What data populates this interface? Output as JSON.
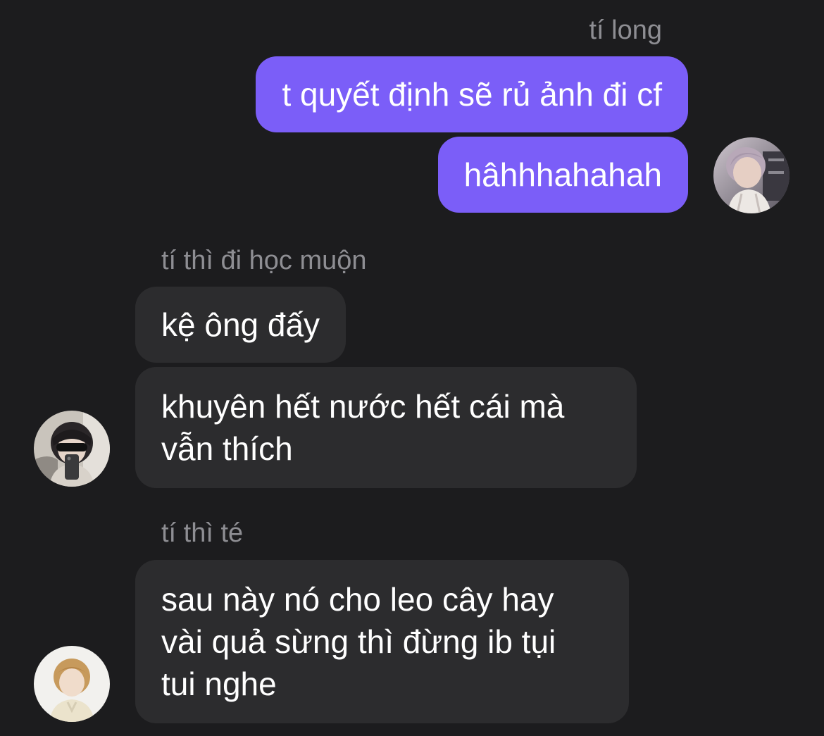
{
  "groups": [
    {
      "sender": "tí long",
      "direction": "outgoing",
      "avatar_icon": "user-avatar-icon",
      "messages": [
        {
          "lines": [
            "t quyết định sẽ rủ ảnh đi cf"
          ]
        },
        {
          "lines": [
            "hâhhhahahah"
          ]
        }
      ]
    },
    {
      "sender": "tí thì đi học muộn",
      "direction": "incoming",
      "avatar_icon": "user-avatar-icon",
      "messages": [
        {
          "lines": [
            "kệ ông đấy"
          ]
        },
        {
          "lines": [
            "khuyên hết nước hết cái mà",
            "vẫn thích"
          ]
        }
      ]
    },
    {
      "sender": "tí thì té",
      "direction": "incoming",
      "avatar_icon": "user-avatar-icon",
      "messages": [
        {
          "lines": [
            "sau này nó cho leo cây hay",
            "vài quả sừng thì đừng ib tụi",
            "tui nghe"
          ]
        }
      ]
    }
  ],
  "colors": {
    "background": "#1c1c1e",
    "outgoing_bubble": "#7b5ef8",
    "incoming_bubble": "#2c2c2e",
    "sender_name": "#8e8e93",
    "message_text": "#ffffff"
  }
}
